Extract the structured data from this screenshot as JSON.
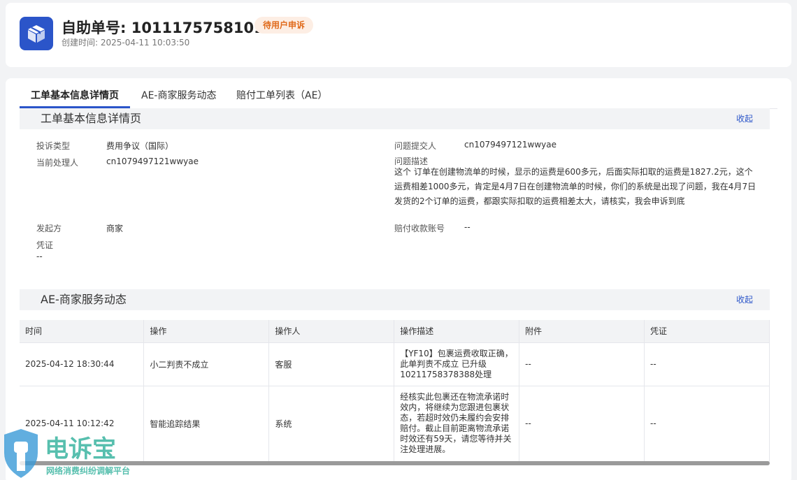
{
  "header": {
    "title": "自助单号: 10111757581013",
    "status": "待用户申诉",
    "created": "创建时间: 2025-04-11 10:03:50",
    "brand_color": "#2b55c9",
    "status_color": "#e06a1b"
  },
  "tabs": [
    {
      "label": "工单基本信息详情页",
      "active": true
    },
    {
      "label": "AE-商家服务动态",
      "active": false
    },
    {
      "label": "赔付工单列表（AE）",
      "active": false
    }
  ],
  "basic_info": {
    "section_title": "工单基本信息详情页",
    "collapse": "收起",
    "complaint_type_label": "投诉类型",
    "complaint_type_value": "费用争议（国际）",
    "current_handler_label": "当前处理人",
    "current_handler_value": "cn1079497121wwyae",
    "submitter_label": "问题提交人",
    "submitter_value": "cn1079497121wwyae",
    "problem_desc_label": "问题描述",
    "problem_desc_value": "这个 订单在创建物流单的时候，显示的运费是600多元，后面实际扣取的运费是1827.2元，这个运费相差1000多元，肯定是4月7日在创建物流单的时候，你们的系统是出现了问题，我在4月7日发货的2个订单的运费，都跟实际扣取的运费相差太大，请核实，我会申诉到底",
    "initiator_label": "发起方",
    "initiator_value": "商家",
    "payout_account_label": "赔付收款账号",
    "payout_account_value": "--",
    "evidence_label": "凭证",
    "evidence_value": "--"
  },
  "service_dynamics": {
    "section_title": "AE-商家服务动态",
    "collapse": "收起",
    "columns": [
      "时间",
      "操作",
      "操作人",
      "操作描述",
      "附件",
      "凭证"
    ],
    "rows": [
      [
        "2025-04-12 18:30:44",
        "小二判责不成立",
        "客服",
        "【YF10】包裹运费收取正确，此单判责不成立 已升级10211758378388处理",
        "--",
        "--"
      ],
      [
        "2025-04-11 10:12:42",
        "智能追踪结果",
        "系统",
        "经核实此包裹还在物流承诺时效内，将继续为您跟进包裹状态，若超时效仍未履约会安排赔付。截止目前距离物流承诺时效还有59天，请您等待并关注处理进展。",
        "--",
        "--"
      ]
    ]
  },
  "watermark": {
    "brand": "电诉宝",
    "subtitle": "网络消费纠纷调解平台"
  }
}
